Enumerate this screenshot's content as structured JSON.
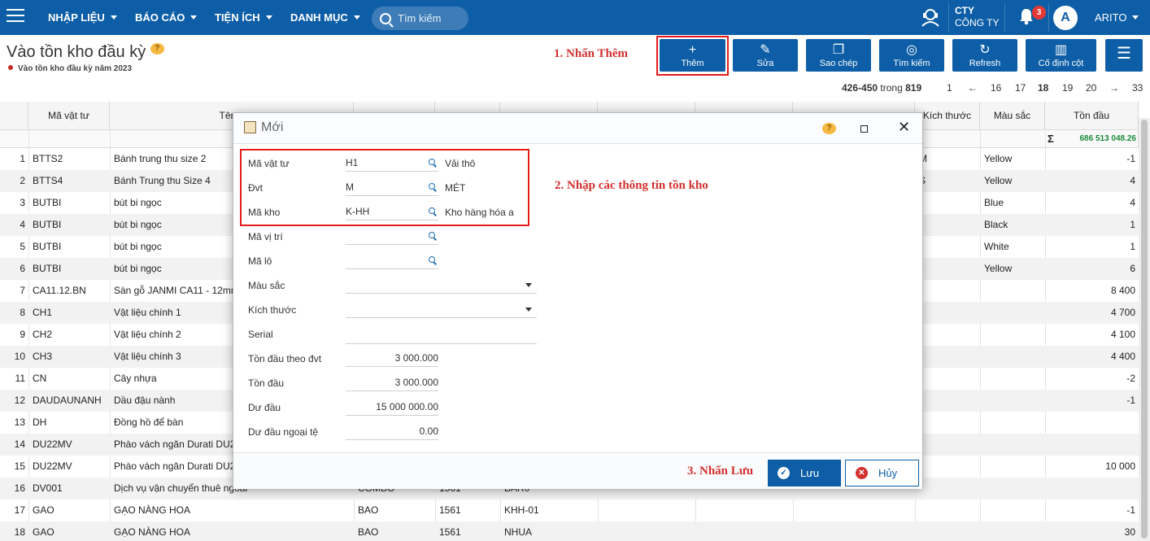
{
  "nav": {
    "menus": [
      "NHẬP LIỆU",
      "BÁO CÁO",
      "TIỆN ÍCH",
      "DANH MỤC"
    ],
    "search_placeholder": "Tìm kiếm",
    "company_short": "CTY",
    "company_name": "CÔNG TY",
    "notification_count": "3",
    "avatar_letter": "A",
    "user": "ARITO",
    "colors": {
      "bar": "#0d5ea6",
      "badge": "#e53935"
    }
  },
  "page": {
    "title": "Vào tồn kho đầu kỳ",
    "help": "?",
    "subtitle": "Vào tồn kho đầu kỳ năm 2023"
  },
  "toolbar": {
    "add": "Thêm",
    "edit": "Sửa",
    "copy": "Sao chép",
    "search": "Tìm kiếm",
    "refresh": "Refresh",
    "fix_columns": "Cố định cột"
  },
  "annotations": {
    "step1": "1. Nhấn Thêm",
    "step2": "2. Nhập các thông tin tồn kho",
    "step3": "3. Nhấn Lưu"
  },
  "pager": {
    "range": "426-450",
    "of_label": "trong",
    "total": "819",
    "pages": [
      "1",
      "←",
      "16",
      "17",
      "18",
      "19",
      "20",
      "→",
      "33"
    ],
    "current": "18"
  },
  "grid": {
    "headers": {
      "code": "Mã vật tư",
      "name": "Tên v",
      "size": "Kích thước",
      "color": "Màu sắc",
      "qty": "Tồn đầu"
    },
    "sum_symbol": "Σ",
    "sum_value": "686 513 048.26",
    "rows": [
      {
        "no": "1",
        "code": "BTTS2",
        "name": "Bánh trung thu size 2",
        "unit": "",
        "acc": "",
        "wh": "",
        "size": "M",
        "color": "Yellow",
        "qty": "-1"
      },
      {
        "no": "2",
        "code": "BTTS4",
        "name": "Bánh Trung thu Size 4",
        "unit": "",
        "acc": "",
        "wh": "",
        "size": "S",
        "color": "Yellow",
        "qty": "4"
      },
      {
        "no": "3",
        "code": "BUTBI",
        "name": "bút bi ngọc",
        "unit": "",
        "acc": "",
        "wh": "",
        "size": "",
        "color": "Blue",
        "qty": "4"
      },
      {
        "no": "4",
        "code": "BUTBI",
        "name": "bút bi ngọc",
        "unit": "",
        "acc": "",
        "wh": "",
        "size": "",
        "color": "Black",
        "qty": "1"
      },
      {
        "no": "5",
        "code": "BUTBI",
        "name": "bút bi ngọc",
        "unit": "",
        "acc": "",
        "wh": "",
        "size": "",
        "color": "White",
        "qty": "1"
      },
      {
        "no": "6",
        "code": "BUTBI",
        "name": "bút bi ngọc",
        "unit": "",
        "acc": "",
        "wh": "",
        "size": "",
        "color": "Yellow",
        "qty": "6"
      },
      {
        "no": "7",
        "code": "CA11.12.BN",
        "name": "Sàn gỗ JANMI CA11 - 12mm",
        "unit": "",
        "acc": "",
        "wh": "",
        "size": "",
        "color": "",
        "qty": "8 400"
      },
      {
        "no": "8",
        "code": "CH1",
        "name": "Vật liệu chính 1",
        "unit": "",
        "acc": "",
        "wh": "",
        "size": "",
        "color": "",
        "qty": "4 700"
      },
      {
        "no": "9",
        "code": "CH2",
        "name": "Vật liệu chính 2",
        "unit": "",
        "acc": "",
        "wh": "",
        "size": "",
        "color": "",
        "qty": "4 100"
      },
      {
        "no": "10",
        "code": "CH3",
        "name": "Vật liệu chính 3",
        "unit": "",
        "acc": "",
        "wh": "",
        "size": "",
        "color": "",
        "qty": "4 400"
      },
      {
        "no": "11",
        "code": "CN",
        "name": "Cây nhựa",
        "unit": "",
        "acc": "",
        "wh": "",
        "size": "",
        "color": "",
        "qty": "-2"
      },
      {
        "no": "12",
        "code": "DAUDAUNANH",
        "name": "Dầu đậu nành",
        "unit": "",
        "acc": "",
        "wh": "",
        "size": "",
        "color": "",
        "qty": "-1"
      },
      {
        "no": "13",
        "code": "DH",
        "name": "Đồng hồ để bàn",
        "unit": "",
        "acc": "",
        "wh": "",
        "size": "",
        "color": "",
        "qty": ""
      },
      {
        "no": "14",
        "code": "DU22MV",
        "name": "Phào vách ngăn Durati DU2",
        "unit": "",
        "acc": "",
        "wh": "",
        "size": "",
        "color": "",
        "qty": ""
      },
      {
        "no": "15",
        "code": "DU22MV",
        "name": "Phào vách ngăn Durati DU2",
        "unit": "",
        "acc": "",
        "wh": "",
        "size": "",
        "color": "",
        "qty": "10 000"
      },
      {
        "no": "16",
        "code": "DV001",
        "name": "Dịch vụ vận chuyển thuê ngoài",
        "unit": "COMBO",
        "acc": "1561",
        "wh": "BAR0",
        "size": "",
        "color": "",
        "qty": ""
      },
      {
        "no": "17",
        "code": "GAO",
        "name": "GẠO NÀNG HOA",
        "unit": "BAO",
        "acc": "1561",
        "wh": "KHH-01",
        "size": "",
        "color": "",
        "qty": "-1"
      },
      {
        "no": "18",
        "code": "GAO",
        "name": "GẠO NÀNG HOA",
        "unit": "BAO",
        "acc": "1561",
        "wh": "NHUA",
        "size": "",
        "color": "",
        "qty": "30"
      }
    ]
  },
  "dialog": {
    "title": "Mới",
    "help": "?",
    "fields": {
      "ma_vat_tu": {
        "label": "Mã vật tư",
        "value": "H1",
        "desc": "Vải thô"
      },
      "dvt": {
        "label": "Đvt",
        "value": "M",
        "desc": "MÉT"
      },
      "ma_kho": {
        "label": "Mã kho",
        "value": "K-HH",
        "desc": "Kho hàng hóa a"
      },
      "ma_vi_tri": {
        "label": "Mã vị trí",
        "value": ""
      },
      "ma_lo": {
        "label": "Mã lô",
        "value": ""
      },
      "mau_sac": {
        "label": "Màu sắc",
        "value": ""
      },
      "kich_thuoc": {
        "label": "Kích thước",
        "value": ""
      },
      "serial": {
        "label": "Serial",
        "value": ""
      },
      "ton_dau_dvt": {
        "label": "Tồn đầu theo đvt",
        "value": "3 000.000"
      },
      "ton_dau": {
        "label": "Tồn đầu",
        "value": "3 000.000"
      },
      "du_dau": {
        "label": "Dư đầu",
        "value": "15 000 000.00"
      },
      "du_dau_nt": {
        "label": "Dư đầu ngoại tệ",
        "value": "0.00"
      }
    },
    "save": "Lưu",
    "cancel": "Hủy"
  }
}
